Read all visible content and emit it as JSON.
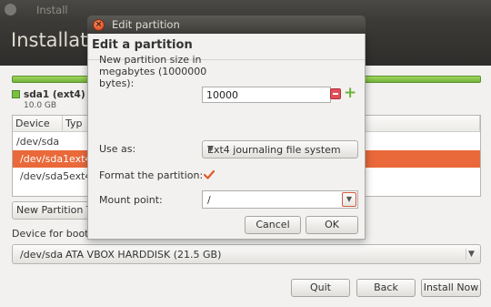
{
  "window": {
    "title": "Install",
    "heading": "Installatio"
  },
  "partition_bar": {
    "legend_name": "sda1 (ext4)",
    "legend_size": "10.0 GB",
    "color": "#7ac143"
  },
  "device_table": {
    "columns": [
      "Device",
      "Typ"
    ],
    "rows": [
      {
        "device": "/dev/sda",
        "type": ""
      },
      {
        "device": "/dev/sda1",
        "type": "ext4"
      },
      {
        "device": "/dev/sda5",
        "type": "ext4"
      }
    ],
    "selected_index": 1,
    "selection_color": "#e9693a"
  },
  "new_partition_table_button": "New Partition Ta",
  "boot_loader": {
    "label": "Device for boot l",
    "device": "/dev/sda",
    "description": "ATA VBOX HARDDISK (21.5 GB)"
  },
  "bottom_buttons": {
    "quit": "Quit",
    "back": "Back",
    "install_now": "Install Now"
  },
  "dialog": {
    "window_title": "Edit partition",
    "heading": "Edit a partition",
    "size_label_line1": "New partition size in",
    "size_label_line2": "megabytes (1000000",
    "size_label_line3": "bytes):",
    "size_value": "10000",
    "use_as_label": "Use as:",
    "use_as_value": "Ext4 journaling file system",
    "format_label": "Format the partition:",
    "format_checked": true,
    "mount_label": "Mount point:",
    "mount_value": "/",
    "cancel": "Cancel",
    "ok": "OK"
  }
}
